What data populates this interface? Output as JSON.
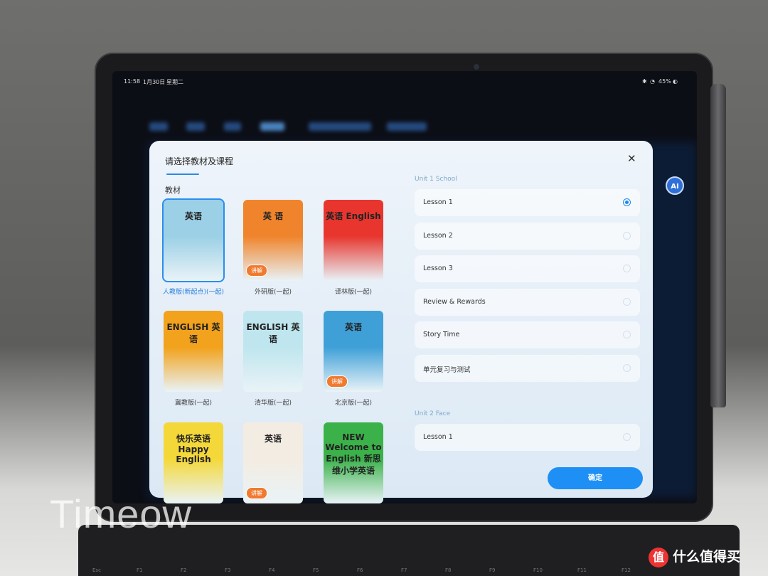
{
  "status_bar": {
    "time": "11:58",
    "date": "1月30日",
    "weekday": "星期二",
    "battery": "45%"
  },
  "modal": {
    "title": "请选择教材及课程",
    "section_label": "教材",
    "close_icon": "close-icon",
    "books": [
      {
        "label": "人教版(新起点)(一起)",
        "cover_title": "英语",
        "color": "#9bd0e6",
        "selected": true,
        "badge": ""
      },
      {
        "label": "外研版(一起)",
        "cover_title": "英 语",
        "color": "#f0842c",
        "selected": false,
        "badge": "讲解"
      },
      {
        "label": "译林版(一起)",
        "cover_title": "英语 English",
        "color": "#e8362f",
        "selected": false,
        "badge": ""
      },
      {
        "label": "冀教版(一起)",
        "cover_title": "ENGLISH 英语",
        "color": "#f2a21c",
        "selected": false,
        "badge": ""
      },
      {
        "label": "清华版(一起)",
        "cover_title": "ENGLISH 英语",
        "color": "#bfe6ee",
        "selected": false,
        "badge": ""
      },
      {
        "label": "北京版(一起)",
        "cover_title": "英语",
        "color": "#3fa0d8",
        "selected": false,
        "badge": "讲解"
      },
      {
        "label": "",
        "cover_title": "快乐英语 Happy English",
        "color": "#f4d83a",
        "selected": false,
        "badge": ""
      },
      {
        "label": "",
        "cover_title": "英语",
        "color": "#f3ece2",
        "selected": false,
        "badge": "讲解"
      },
      {
        "label": "",
        "cover_title": "NEW Welcome to English 新思维小学英语",
        "color": "#3bb14a",
        "selected": false,
        "badge": ""
      }
    ],
    "units": [
      {
        "title": "Unit 1 School",
        "lessons": [
          {
            "label": "Lesson 1",
            "selected": true
          },
          {
            "label": "Lesson 2",
            "selected": false
          },
          {
            "label": "Lesson 3",
            "selected": false
          },
          {
            "label": "Review & Rewards",
            "selected": false
          },
          {
            "label": "Story Time",
            "selected": false
          },
          {
            "label": "单元复习与测试",
            "selected": false
          }
        ]
      },
      {
        "title": "Unit 2 Face",
        "lessons": [
          {
            "label": "Lesson 1",
            "selected": false
          }
        ]
      }
    ],
    "confirm_label": "确定"
  },
  "ai_button": "AI",
  "watermark": "Timeow",
  "logo": {
    "mark": "值",
    "text": "什么值得买"
  },
  "accent": "#1e90f5"
}
